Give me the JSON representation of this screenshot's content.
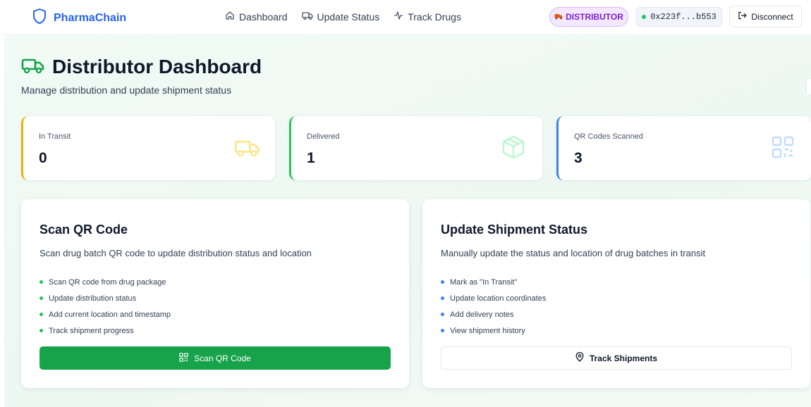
{
  "header": {
    "brand": "PharmaChain",
    "nav": [
      {
        "label": "Dashboard",
        "icon": "home-icon"
      },
      {
        "label": "Update Status",
        "icon": "truck-icon"
      },
      {
        "label": "Track Drugs",
        "icon": "activity-icon"
      }
    ],
    "role_badge": "DISTRIBUTOR",
    "wallet": "0x223f...b553",
    "disconnect": "Disconnect"
  },
  "page": {
    "title": "Distributor Dashboard",
    "subtitle": "Manage distribution and update shipment status"
  },
  "stats": [
    {
      "label": "In Transit",
      "value": "0",
      "accent": "#eab308",
      "icon": "truck-icon",
      "icon_color": "#fde68a"
    },
    {
      "label": "Delivered",
      "value": "1",
      "accent": "#22c55e",
      "icon": "package-icon",
      "icon_color": "#bbf7d0"
    },
    {
      "label": "QR Codes Scanned",
      "value": "3",
      "accent": "#3b82f6",
      "icon": "qr-icon",
      "icon_color": "#bfdbfe"
    }
  ],
  "scan_panel": {
    "title": "Scan QR Code",
    "description": "Scan drug batch QR code to update distribution status and location",
    "items": [
      "Scan QR code from drug package",
      "Update distribution status",
      "Add current location and timestamp",
      "Track shipment progress"
    ],
    "bullet_color": "#22c55e",
    "button": "Scan QR Code"
  },
  "update_panel": {
    "title": "Update Shipment Status",
    "description": "Manually update the status and location of drug batches in transit",
    "items": [
      "Mark as \"In Transit\"",
      "Update location coordinates",
      "Add delivery notes",
      "View shipment history"
    ],
    "bullet_color": "#3b82f6",
    "button": "Track Shipments"
  },
  "colors": {
    "brand": "#2563eb",
    "primary_green": "#16a34a",
    "badge_purple": "#7e22ce"
  }
}
